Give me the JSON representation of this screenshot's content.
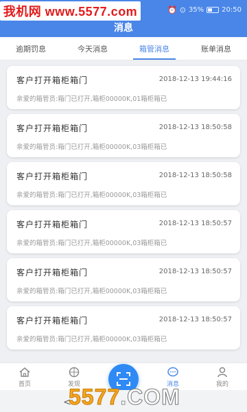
{
  "watermark": {
    "text": "我机网 www.5577.com"
  },
  "status": {
    "battery": "35%",
    "time": "20:50"
  },
  "header": {
    "title": "消息"
  },
  "tabs": [
    {
      "label": "逾期罚息",
      "active": false
    },
    {
      "label": "今天消息",
      "active": false
    },
    {
      "label": "箱管消息",
      "active": true
    },
    {
      "label": "账单消息",
      "active": false
    }
  ],
  "messages": [
    {
      "title": "客户打开箱柜箱门",
      "time": "2018-12-13 19:44:16",
      "body": "亲爱的箱管员:箱门已打开,箱柜00000K,01箱柜箱已"
    },
    {
      "title": "客户打开箱柜箱门",
      "time": "2018-12-13 18:50:58",
      "body": "亲爱的箱管员:箱门已打开,箱柜00000K,03箱柜箱已"
    },
    {
      "title": "客户打开箱柜箱门",
      "time": "2018-12-13 18:50:58",
      "body": "亲爱的箱管员:箱门已打开,箱柜00000K,03箱柜箱已"
    },
    {
      "title": "客户打开箱柜箱门",
      "time": "2018-12-13 18:50:57",
      "body": "亲爱的箱管员:箱门已打开,箱柜00000K,03箱柜箱已"
    },
    {
      "title": "客户打开箱柜箱门",
      "time": "2018-12-13 18:50:57",
      "body": "亲爱的箱管员:箱门已打开,箱柜00000K,03箱柜箱已"
    },
    {
      "title": "客户打开箱柜箱门",
      "time": "2018-12-13 18:50:57",
      "body": "亲爱的箱管员:箱门已打开,箱柜00000K,03箱柜箱已"
    }
  ],
  "nav": [
    {
      "label": "首页",
      "icon": "home-icon",
      "active": false
    },
    {
      "label": "发现",
      "icon": "compass-icon",
      "active": false
    },
    {
      "label": "消息",
      "icon": "message-icon",
      "active": true
    },
    {
      "label": "我的",
      "icon": "person-icon",
      "active": false
    }
  ],
  "brand": {
    "num": "5577",
    "dot": ".",
    "com": "COM"
  },
  "colors": {
    "primary": "#4a86e8",
    "scan": "#2f8af5",
    "brand_orange": "#f5a623"
  }
}
